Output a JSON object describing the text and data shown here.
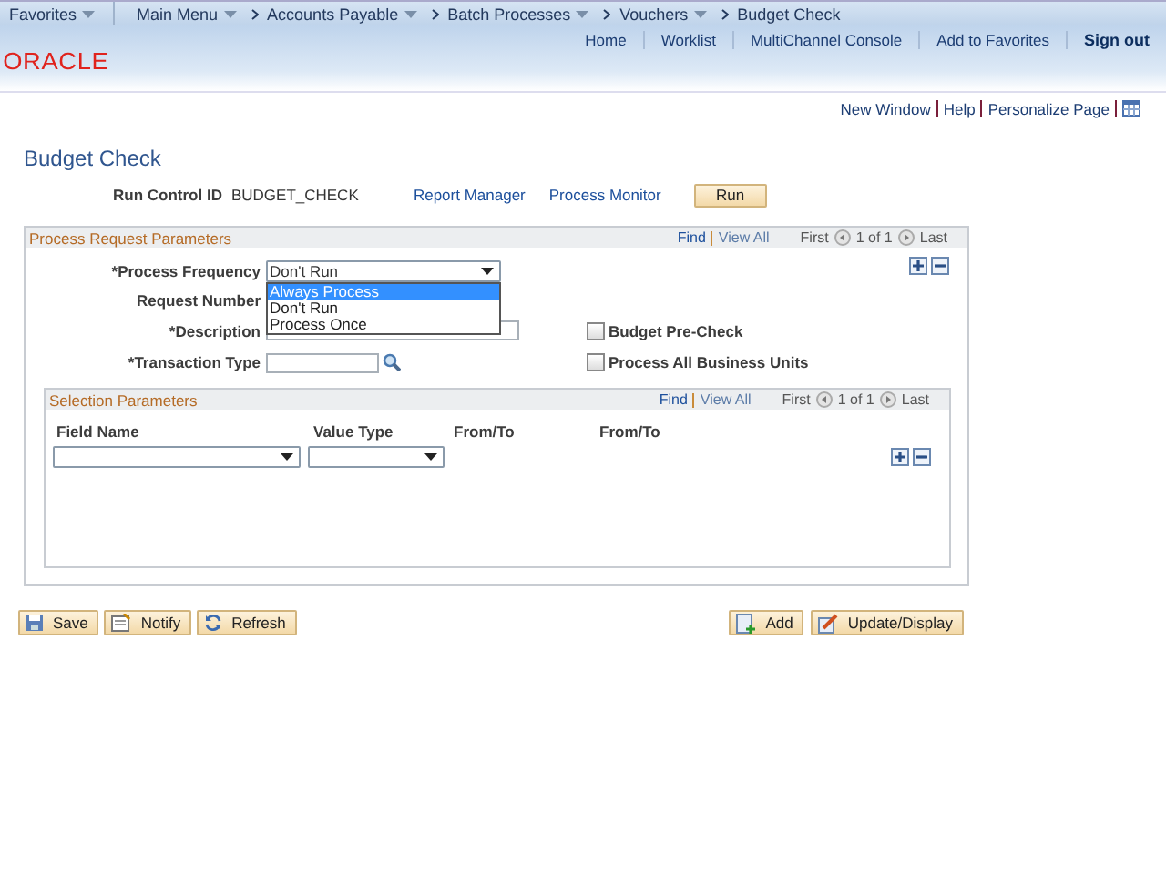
{
  "nav": {
    "favorites": "Favorites",
    "main_menu": "Main Menu",
    "breadcrumbs": [
      "Accounts Payable",
      "Batch Processes",
      "Vouchers"
    ],
    "current": "Budget Check"
  },
  "header_links": [
    "Home",
    "Worklist",
    "MultiChannel Console",
    "Add to Favorites"
  ],
  "sign_out": "Sign out",
  "logo": "ORACLE",
  "page_links": [
    "New Window",
    "Help",
    "Personalize Page"
  ],
  "title": "Budget Check",
  "run_control": {
    "label": "Run Control ID",
    "value": "BUDGET_CHECK",
    "links": [
      "Report Manager",
      "Process Monitor"
    ],
    "run_button": "Run"
  },
  "section": {
    "title": "Process Request Parameters",
    "find": "Find",
    "view_all": "View All",
    "first": "First",
    "count": "1 of 1",
    "last": "Last"
  },
  "process_frequency": {
    "label": "*Process Frequency",
    "value": "Don't Run",
    "expanded": true,
    "options": [
      {
        "label": "Always Process",
        "highlighted": true
      },
      {
        "label": "Don't Run",
        "highlighted": false
      },
      {
        "label": "Process Once",
        "highlighted": false
      }
    ]
  },
  "request_number": {
    "label": "Request Number"
  },
  "description": {
    "label": "*Description"
  },
  "transaction_type": {
    "label": "*Transaction Type"
  },
  "checkboxes": [
    {
      "label": "Budget Pre-Check",
      "checked": false
    },
    {
      "label": "Process All Business Units",
      "checked": false
    }
  ],
  "selection": {
    "title": "Selection Parameters",
    "find": "Find",
    "view_all": "View All",
    "first": "First",
    "count": "1 of 1",
    "last": "Last",
    "columns": [
      "Field Name",
      "Value Type",
      "From/To",
      "From/To"
    ]
  },
  "buttons_left": [
    {
      "label": "Save",
      "kind": "save"
    },
    {
      "label": "Notify",
      "kind": "notify"
    },
    {
      "label": "Refresh",
      "kind": "refresh"
    }
  ],
  "buttons_right": [
    {
      "label": "Add",
      "kind": "add"
    },
    {
      "label": "Update/Display",
      "kind": "update"
    }
  ]
}
